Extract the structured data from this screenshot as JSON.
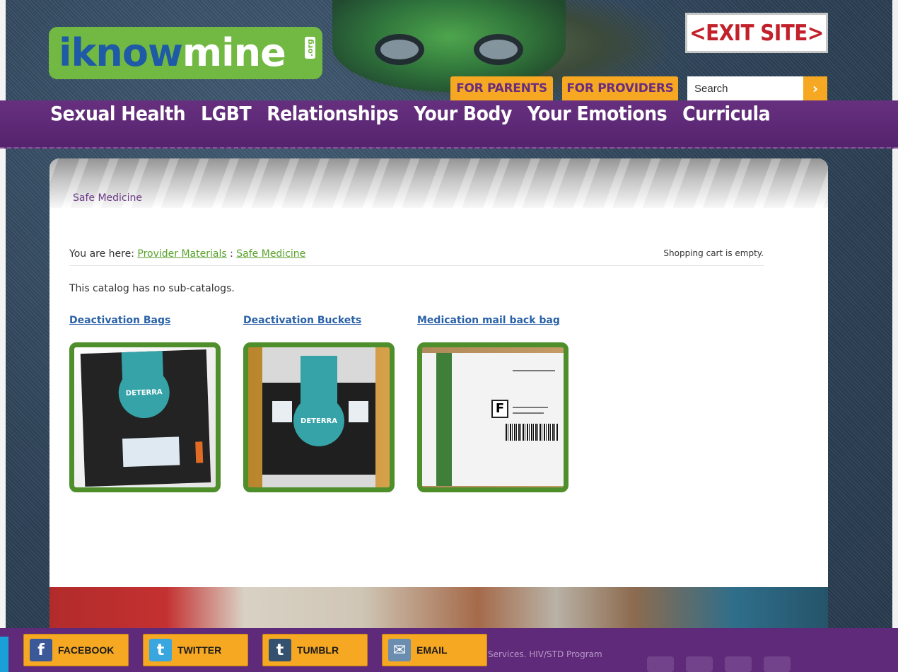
{
  "header": {
    "logo": {
      "part1": "iknow",
      "part2": "mine",
      "tld": ".org"
    },
    "exit_label": "<EXIT SITE>",
    "top_links": [
      "FOR PARENTS",
      "FOR PROVIDERS"
    ],
    "search": {
      "value": "Search",
      "button_icon": "chevron-right-icon",
      "button_glyph": "›"
    }
  },
  "nav": {
    "items": [
      "Sexual Health",
      "LGBT",
      "Relationships",
      "Your Body",
      "Your Emotions",
      "Curricula"
    ]
  },
  "content": {
    "page_title": "Safe Medicine",
    "breadcrumb_prefix": "You are here:",
    "breadcrumb": [
      "Provider Materials",
      "Safe Medicine"
    ],
    "breadcrumb_sep": ":",
    "cart_status": "Shopping cart is empty.",
    "no_subcatalogs": "This catalog has no sub-catalogs.",
    "items": [
      {
        "title": "Deactivation Bags",
        "label": "DETERRA"
      },
      {
        "title": "Deactivation Buckets",
        "label": "DETERRA"
      },
      {
        "title": "Medication mail back bag",
        "label": "F"
      }
    ]
  },
  "footer": {
    "share": [
      {
        "label": "FACEBOOK",
        "icon": "facebook-icon",
        "glyph": "f"
      },
      {
        "label": "TWITTER",
        "icon": "twitter-icon",
        "glyph": "t"
      },
      {
        "label": "TUMBLR",
        "icon": "tumblr-icon",
        "glyph": "t"
      },
      {
        "label": "EMAIL",
        "icon": "email-icon",
        "glyph": "✉"
      }
    ],
    "text": "Services. HIV/STD Program"
  },
  "colors": {
    "purple": "#5f2a7a",
    "orange": "#f6a823",
    "green": "#72b944",
    "link_blue": "#2a62a8",
    "exit_red": "#c2202a"
  }
}
